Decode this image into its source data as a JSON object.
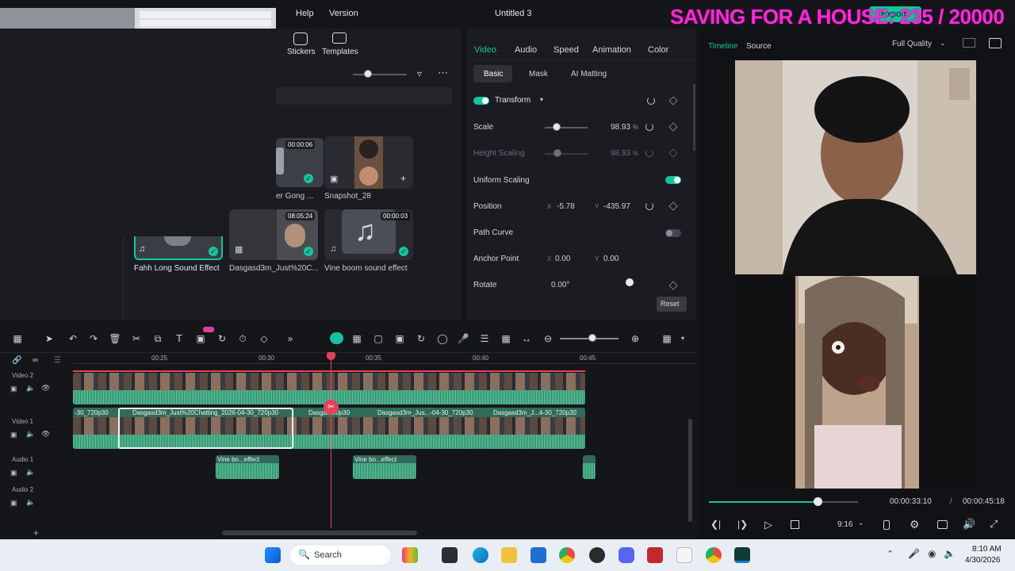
{
  "menu": {
    "help": "Help",
    "version": "Version"
  },
  "window_title": "Untitled 3",
  "overlay_text": "SAVING FOR A HOUSE: 235 / 20000",
  "export_label": "Export",
  "media": {
    "stickers": "Stickers",
    "templates": "Templates",
    "items": [
      {
        "caption": "er Gong ...",
        "duration": "00:00:06"
      },
      {
        "caption": "Snapshot_28",
        "duration": ""
      },
      {
        "caption": "Fahh Long Sound Effect",
        "duration": ""
      },
      {
        "caption": "Dasgasd3m_Just%20C...",
        "duration": "08:05:24"
      },
      {
        "caption": "Vine boom sound effect",
        "duration": "00:00:03"
      }
    ]
  },
  "props": {
    "tabs": [
      "Video",
      "Audio",
      "Speed",
      "Animation",
      "Color"
    ],
    "subtabs": [
      "Basic",
      "Mask",
      "AI Matting"
    ],
    "transform": "Transform",
    "scale_label": "Scale",
    "scale_value": "98.93",
    "scale_unit": "%",
    "height_label": "Height Scaling",
    "height_value": "98.93",
    "height_unit": "%",
    "uniform_label": "Uniform Scaling",
    "position_label": "Position",
    "pos_x_axis": "X",
    "pos_x": "-5.78",
    "pos_y_axis": "Y",
    "pos_y": "-435.97",
    "path_curve_label": "Path Curve",
    "anchor_label": "Anchor Point",
    "anchor_x_axis": "X",
    "anchor_x": "0.00",
    "anchor_y_axis": "Y",
    "anchor_y": "0.00",
    "rotate_label": "Rotate",
    "rotate_value": "0.00°",
    "reset": "Reset"
  },
  "preview": {
    "timeline_tab": "Timeline",
    "source_tab": "Source",
    "quality": "Full Quality",
    "current_time": "00:00:33:10",
    "separator": "/",
    "total_time": "00:00:45:18",
    "aspect": "9:16",
    "progress": 0.73
  },
  "timeline": {
    "ruler": [
      "00:25",
      "00:30",
      "00:35",
      "00:40",
      "00:45"
    ],
    "tracks": [
      "Video 2",
      "Video 1",
      "Audio 1",
      "Audio 2"
    ],
    "video1_clips": [
      {
        "label": "-30_720p30"
      },
      {
        "label": "Dasgasd3m_Just%20Chatting_2026-04-30_720p30"
      },
      {
        "label": "Dasga...20p30"
      },
      {
        "label": "Dasgasd3m_Jus...-04-30_720p30"
      },
      {
        "label": "Dasgasd3m_J...4-30_720p30"
      }
    ],
    "audio1_clips": [
      {
        "label": "Vine bo...effect"
      },
      {
        "label": "Vine bo...effect"
      }
    ]
  },
  "taskbar": {
    "search": "Search",
    "time": "8:10 AM",
    "date": "4/30/2026"
  }
}
